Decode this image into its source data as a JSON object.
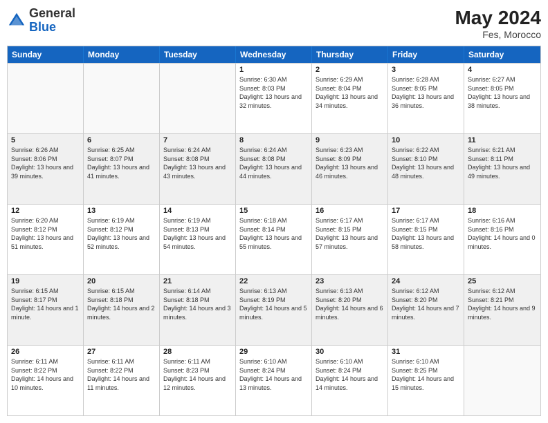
{
  "header": {
    "logo_general": "General",
    "logo_blue": "Blue",
    "month_year": "May 2024",
    "location": "Fes, Morocco"
  },
  "days_of_week": [
    "Sunday",
    "Monday",
    "Tuesday",
    "Wednesday",
    "Thursday",
    "Friday",
    "Saturday"
  ],
  "rows": [
    [
      {
        "day": "",
        "detail": "",
        "empty": true
      },
      {
        "day": "",
        "detail": "",
        "empty": true
      },
      {
        "day": "",
        "detail": "",
        "empty": true
      },
      {
        "day": "1",
        "detail": "Sunrise: 6:30 AM\nSunset: 8:03 PM\nDaylight: 13 hours\nand 32 minutes."
      },
      {
        "day": "2",
        "detail": "Sunrise: 6:29 AM\nSunset: 8:04 PM\nDaylight: 13 hours\nand 34 minutes."
      },
      {
        "day": "3",
        "detail": "Sunrise: 6:28 AM\nSunset: 8:05 PM\nDaylight: 13 hours\nand 36 minutes."
      },
      {
        "day": "4",
        "detail": "Sunrise: 6:27 AM\nSunset: 8:05 PM\nDaylight: 13 hours\nand 38 minutes."
      }
    ],
    [
      {
        "day": "5",
        "detail": "Sunrise: 6:26 AM\nSunset: 8:06 PM\nDaylight: 13 hours\nand 39 minutes."
      },
      {
        "day": "6",
        "detail": "Sunrise: 6:25 AM\nSunset: 8:07 PM\nDaylight: 13 hours\nand 41 minutes."
      },
      {
        "day": "7",
        "detail": "Sunrise: 6:24 AM\nSunset: 8:08 PM\nDaylight: 13 hours\nand 43 minutes."
      },
      {
        "day": "8",
        "detail": "Sunrise: 6:24 AM\nSunset: 8:08 PM\nDaylight: 13 hours\nand 44 minutes."
      },
      {
        "day": "9",
        "detail": "Sunrise: 6:23 AM\nSunset: 8:09 PM\nDaylight: 13 hours\nand 46 minutes."
      },
      {
        "day": "10",
        "detail": "Sunrise: 6:22 AM\nSunset: 8:10 PM\nDaylight: 13 hours\nand 48 minutes."
      },
      {
        "day": "11",
        "detail": "Sunrise: 6:21 AM\nSunset: 8:11 PM\nDaylight: 13 hours\nand 49 minutes."
      }
    ],
    [
      {
        "day": "12",
        "detail": "Sunrise: 6:20 AM\nSunset: 8:12 PM\nDaylight: 13 hours\nand 51 minutes."
      },
      {
        "day": "13",
        "detail": "Sunrise: 6:19 AM\nSunset: 8:12 PM\nDaylight: 13 hours\nand 52 minutes."
      },
      {
        "day": "14",
        "detail": "Sunrise: 6:19 AM\nSunset: 8:13 PM\nDaylight: 13 hours\nand 54 minutes."
      },
      {
        "day": "15",
        "detail": "Sunrise: 6:18 AM\nSunset: 8:14 PM\nDaylight: 13 hours\nand 55 minutes."
      },
      {
        "day": "16",
        "detail": "Sunrise: 6:17 AM\nSunset: 8:15 PM\nDaylight: 13 hours\nand 57 minutes."
      },
      {
        "day": "17",
        "detail": "Sunrise: 6:17 AM\nSunset: 8:15 PM\nDaylight: 13 hours\nand 58 minutes."
      },
      {
        "day": "18",
        "detail": "Sunrise: 6:16 AM\nSunset: 8:16 PM\nDaylight: 14 hours\nand 0 minutes."
      }
    ],
    [
      {
        "day": "19",
        "detail": "Sunrise: 6:15 AM\nSunset: 8:17 PM\nDaylight: 14 hours\nand 1 minute."
      },
      {
        "day": "20",
        "detail": "Sunrise: 6:15 AM\nSunset: 8:18 PM\nDaylight: 14 hours\nand 2 minutes."
      },
      {
        "day": "21",
        "detail": "Sunrise: 6:14 AM\nSunset: 8:18 PM\nDaylight: 14 hours\nand 3 minutes."
      },
      {
        "day": "22",
        "detail": "Sunrise: 6:13 AM\nSunset: 8:19 PM\nDaylight: 14 hours\nand 5 minutes."
      },
      {
        "day": "23",
        "detail": "Sunrise: 6:13 AM\nSunset: 8:20 PM\nDaylight: 14 hours\nand 6 minutes."
      },
      {
        "day": "24",
        "detail": "Sunrise: 6:12 AM\nSunset: 8:20 PM\nDaylight: 14 hours\nand 7 minutes."
      },
      {
        "day": "25",
        "detail": "Sunrise: 6:12 AM\nSunset: 8:21 PM\nDaylight: 14 hours\nand 9 minutes."
      }
    ],
    [
      {
        "day": "26",
        "detail": "Sunrise: 6:11 AM\nSunset: 8:22 PM\nDaylight: 14 hours\nand 10 minutes."
      },
      {
        "day": "27",
        "detail": "Sunrise: 6:11 AM\nSunset: 8:22 PM\nDaylight: 14 hours\nand 11 minutes."
      },
      {
        "day": "28",
        "detail": "Sunrise: 6:11 AM\nSunset: 8:23 PM\nDaylight: 14 hours\nand 12 minutes."
      },
      {
        "day": "29",
        "detail": "Sunrise: 6:10 AM\nSunset: 8:24 PM\nDaylight: 14 hours\nand 13 minutes."
      },
      {
        "day": "30",
        "detail": "Sunrise: 6:10 AM\nSunset: 8:24 PM\nDaylight: 14 hours\nand 14 minutes."
      },
      {
        "day": "31",
        "detail": "Sunrise: 6:10 AM\nSunset: 8:25 PM\nDaylight: 14 hours\nand 15 minutes."
      },
      {
        "day": "",
        "detail": "",
        "empty": true
      }
    ]
  ]
}
